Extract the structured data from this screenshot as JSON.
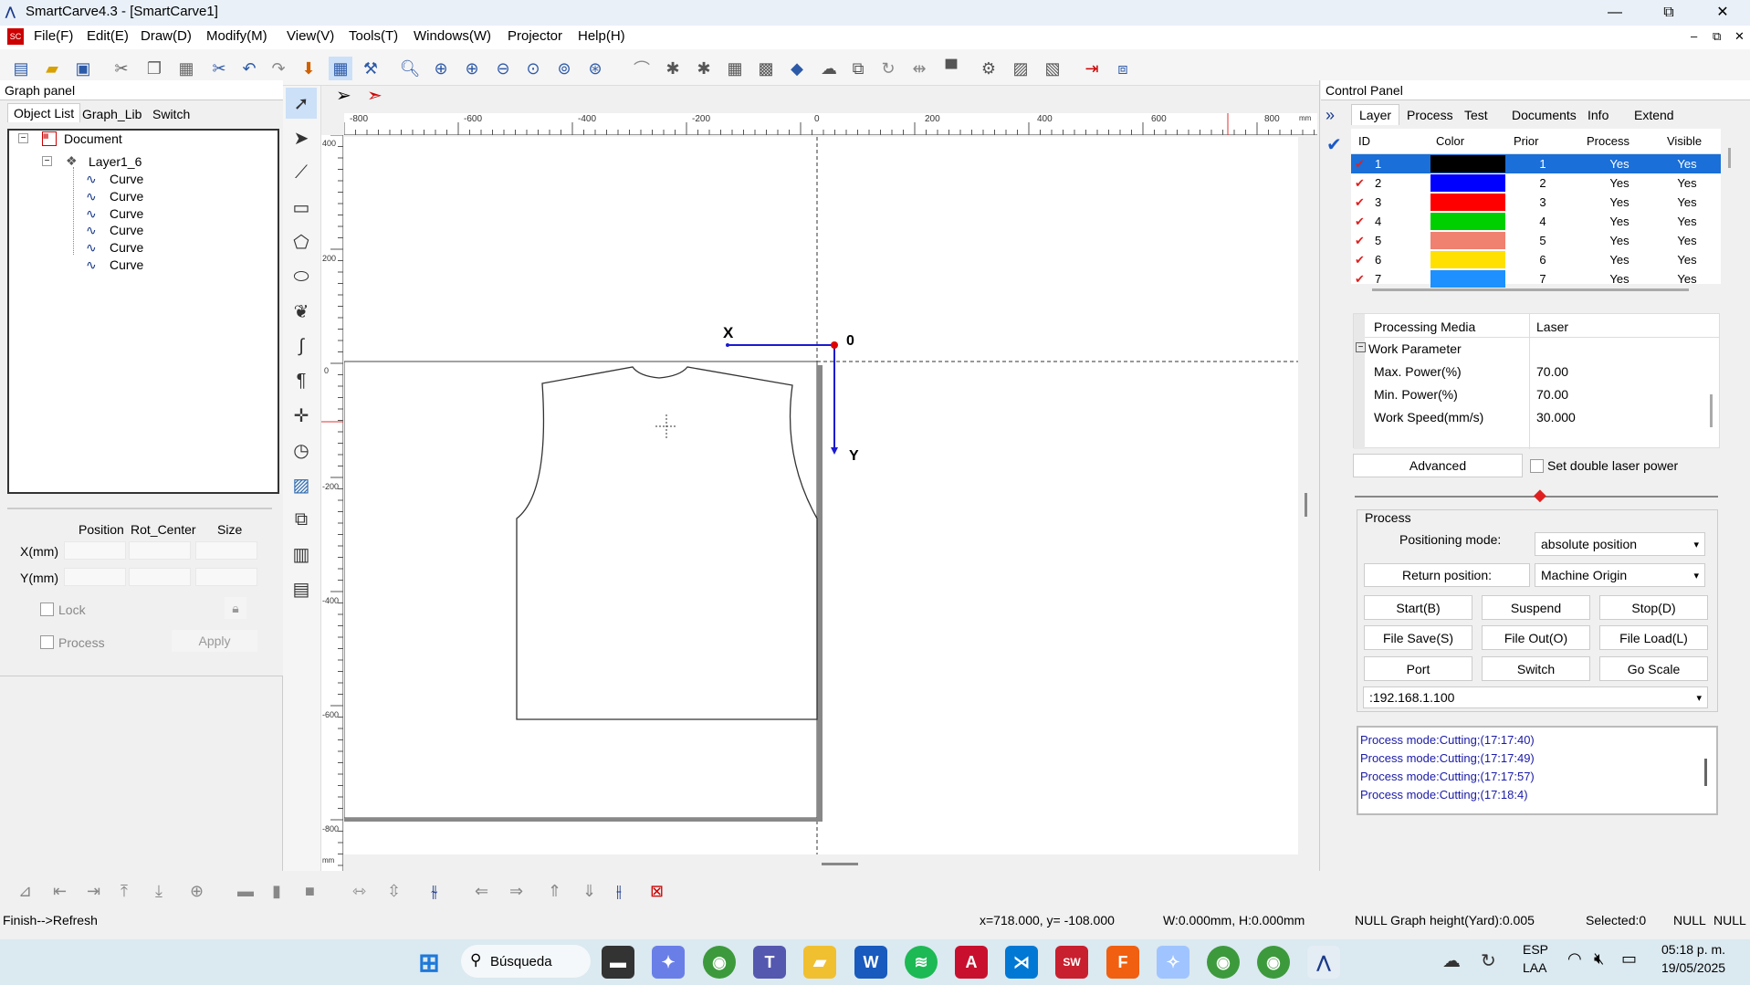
{
  "title_bar": {
    "title": "SmartCarve4.3 - [SmartCarve1]",
    "minimize": "—",
    "restore": "⧉",
    "close": "✕"
  },
  "menu": [
    "File(F)",
    "Edit(E)",
    "Draw(D)",
    "Modify(M)",
    "View(V)",
    "Tools(T)",
    "Windows(W)",
    "Projector",
    "Help(H)"
  ],
  "graph_panel": {
    "title": "Graph panel",
    "tabs": [
      "Object List",
      "Graph_Lib",
      "Switch"
    ],
    "tree": {
      "root": "Document",
      "layer": "Layer1_6",
      "items": [
        "Curve",
        "Curve",
        "Curve",
        "Curve",
        "Curve",
        "Curve"
      ]
    },
    "headers": {
      "position": "Position",
      "rot_center": "Rot_Center",
      "size": "Size"
    },
    "x_label": "X(mm)",
    "y_label": "Y(mm)",
    "lock_label": "Lock",
    "process_label": "Process",
    "apply_label": "Apply"
  },
  "ruler": {
    "top_labels": [
      "-800",
      "-600",
      "-400",
      "-200",
      "0",
      "200",
      "400",
      "600",
      "800",
      "mm"
    ],
    "left_labels": [
      "400",
      "200",
      "0",
      "-200",
      "-400",
      "-600",
      "-800",
      "mm"
    ]
  },
  "canvas": {
    "origin_label": "0",
    "x_axis_label": "X",
    "y_axis_label": "Y"
  },
  "control_panel": {
    "title": "Control Panel",
    "tabs": [
      "Layer",
      "Process",
      "Test",
      "Documents",
      "Info",
      "Extend"
    ],
    "layer_table": {
      "headers": [
        "ID",
        "Color",
        "Prior",
        "Process",
        "Visible"
      ],
      "rows": [
        {
          "id": "1",
          "color": "#000000",
          "prior": "1",
          "process": "Yes",
          "visible": "Yes"
        },
        {
          "id": "2",
          "color": "#0000ff",
          "prior": "2",
          "process": "Yes",
          "visible": "Yes"
        },
        {
          "id": "3",
          "color": "#ff0000",
          "prior": "3",
          "process": "Yes",
          "visible": "Yes"
        },
        {
          "id": "4",
          "color": "#00d000",
          "prior": "4",
          "process": "Yes",
          "visible": "Yes"
        },
        {
          "id": "5",
          "color": "#f08070",
          "prior": "5",
          "process": "Yes",
          "visible": "Yes"
        },
        {
          "id": "6",
          "color": "#ffe000",
          "prior": "6",
          "process": "Yes",
          "visible": "Yes"
        },
        {
          "id": "7",
          "color": "#1e90ff",
          "prior": "7",
          "process": "Yes",
          "visible": "Yes"
        }
      ]
    },
    "properties": {
      "media_label": "Processing Media",
      "media_value": "Laser",
      "group_label": "Work Parameter",
      "max_power_label": "Max. Power(%)",
      "max_power_value": "70.00",
      "min_power_label": "Min. Power(%)",
      "min_power_value": "70.00",
      "speed_label": "Work Speed(mm/s)",
      "speed_value": "30.000"
    },
    "advanced_label": "Advanced",
    "double_laser_label": "Set double laser power",
    "process_group_label": "Process",
    "positioning_label": "Positioning mode:",
    "positioning_value": "absolute position",
    "return_label": "Return position:",
    "return_value": "Machine Origin",
    "buttons": [
      "Start(B)",
      "Suspend",
      "Stop(D)",
      "File Save(S)",
      "File Out(O)",
      "File Load(L)",
      "Port",
      "Switch",
      "Go Scale"
    ],
    "ip_value": ":192.168.1.100",
    "log": [
      "Process mode:Cutting;(17:17:40)",
      "Process mode:Cutting;(17:17:49)",
      "Process mode:Cutting;(17:17:57)",
      "Process mode:Cutting;(17:18:4)"
    ]
  },
  "status_bar": {
    "left": "Finish-->Refresh",
    "coords": "x=718.000, y= -108.000",
    "size": "W:0.000mm, H:0.000mm",
    "graph_height": "NULL Graph height(Yard):0.005",
    "selected": "Selected:0",
    "null1": "NULL",
    "null2": "NULL"
  },
  "taskbar": {
    "search_label": "Búsqueda",
    "lang_top": "ESP",
    "lang_bottom": "LAA",
    "time": "05:18 p. m.",
    "date": "19/05/2025"
  }
}
